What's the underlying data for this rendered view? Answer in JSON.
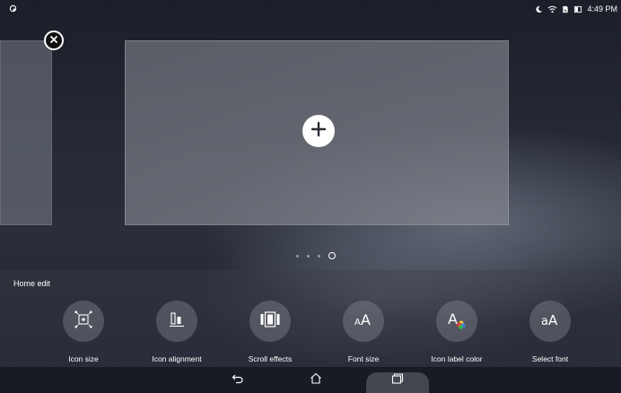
{
  "status_bar": {
    "time": "4:49 PM",
    "icons": [
      "notification-icon",
      "moon-icon",
      "wifi-icon",
      "sim-icon",
      "battery-icon"
    ]
  },
  "home_edit": {
    "title": "Home edit",
    "options": [
      {
        "label": "Icon size",
        "icon": "icon-size-icon"
      },
      {
        "label": "Icon alignment",
        "icon": "icon-alignment-icon"
      },
      {
        "label": "Scroll effects",
        "icon": "scroll-effects-icon"
      },
      {
        "label": "Font size",
        "icon": "font-size-icon",
        "glyph": "AA"
      },
      {
        "label": "Icon label color",
        "icon": "icon-label-color-icon",
        "glyph": "A"
      },
      {
        "label": "Select font",
        "icon": "select-font-icon",
        "glyph": "aA"
      }
    ]
  },
  "pages": {
    "count": 4,
    "active_index": 3
  },
  "nav": {
    "buttons": [
      "back",
      "home",
      "recents"
    ]
  }
}
